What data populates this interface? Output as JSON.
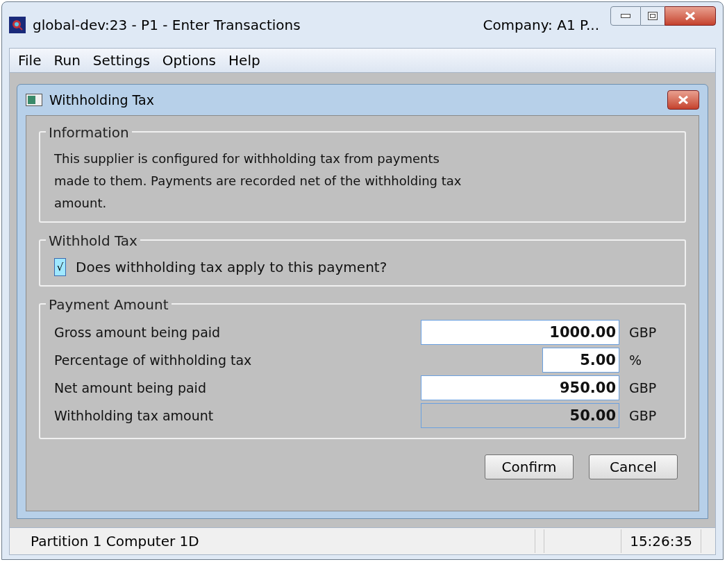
{
  "window": {
    "title": "global-dev:23 - P1 - Enter Transactions",
    "company": "Company: A1  P..."
  },
  "menu": [
    "File",
    "Run",
    "Settings",
    "Options",
    "Help"
  ],
  "dialog": {
    "title": "Withholding Tax",
    "information": {
      "legend": "Information",
      "text": "This supplier is configured for withholding tax from payments made to them. Payments are recorded net of the withholding tax amount."
    },
    "withhold": {
      "legend": "Withhold Tax",
      "label": "Does withholding tax apply to this payment?",
      "checked": true,
      "mark": "√"
    },
    "payment": {
      "legend": "Payment Amount",
      "fields": [
        {
          "label": "Gross amount being paid",
          "value": "1000.00",
          "unit": "GBP",
          "kind": "amount",
          "readonly": false
        },
        {
          "label": "Percentage of withholding tax",
          "value": "5.00",
          "unit": "%",
          "kind": "percent",
          "readonly": false
        },
        {
          "label": "Net amount being paid",
          "value": "950.00",
          "unit": "GBP",
          "kind": "amount",
          "readonly": false
        },
        {
          "label": "Withholding tax amount",
          "value": "50.00",
          "unit": "GBP",
          "kind": "amount",
          "readonly": true
        }
      ]
    },
    "buttons": [
      "Confirm",
      "Cancel"
    ]
  },
  "status_bar": {
    "text": "Partition 1 Computer 1D",
    "time": "15:26:35"
  }
}
